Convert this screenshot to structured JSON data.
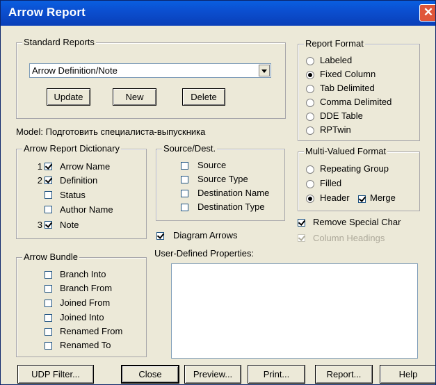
{
  "window": {
    "title": "Arrow Report",
    "close_glyph": "✕"
  },
  "standard_reports": {
    "legend": "Standard Reports",
    "selected": "Arrow Definition/Note",
    "update_label": "Update",
    "new_label": "New",
    "delete_label": "Delete"
  },
  "report_format": {
    "legend": "Report Format",
    "options": [
      {
        "label": "Labeled",
        "checked": false
      },
      {
        "label": "Fixed Column",
        "checked": true
      },
      {
        "label": "Tab Delimited",
        "checked": false
      },
      {
        "label": "Comma Delimited",
        "checked": false
      },
      {
        "label": "DDE Table",
        "checked": false
      },
      {
        "label": "RPTwin",
        "checked": false
      }
    ]
  },
  "model": {
    "label": "Model: ",
    "name": "Подготовить специалиста-выпускника"
  },
  "dictionary": {
    "legend": "Arrow Report Dictionary",
    "items": [
      {
        "num": "1",
        "label": "Arrow Name",
        "checked": true
      },
      {
        "num": "2",
        "label": "Definition",
        "checked": true
      },
      {
        "num": "",
        "label": "Status",
        "checked": false
      },
      {
        "num": "",
        "label": "Author Name",
        "checked": false
      },
      {
        "num": "3",
        "label": "Note",
        "checked": true
      }
    ]
  },
  "source_dest": {
    "legend": "Source/Dest.",
    "items": [
      {
        "label": "Source",
        "checked": false
      },
      {
        "label": "Source Type",
        "checked": false
      },
      {
        "label": "Destination Name",
        "checked": false
      },
      {
        "label": "Destination Type",
        "checked": false
      }
    ]
  },
  "multi_valued": {
    "legend": "Multi-Valued Format",
    "repeating": "Repeating Group",
    "filled": "Filled",
    "header": "Header",
    "merge": "Merge",
    "selected": "Header",
    "merge_checked": true
  },
  "remove_special": {
    "label": "Remove Special Char",
    "checked": true
  },
  "column_headings": {
    "label": "Column Headings",
    "checked": true,
    "disabled": true
  },
  "diagram_arrows": {
    "label": "Diagram Arrows",
    "checked": true
  },
  "udp": {
    "label": "User-Defined Properties:"
  },
  "bundle": {
    "legend": "Arrow Bundle",
    "items": [
      {
        "label": "Branch Into",
        "checked": false
      },
      {
        "label": "Branch From",
        "checked": false
      },
      {
        "label": "Joined From",
        "checked": false
      },
      {
        "label": "Joined Into",
        "checked": false
      },
      {
        "label": "Renamed From",
        "checked": false
      },
      {
        "label": "Renamed To",
        "checked": false
      }
    ]
  },
  "buttons": {
    "udp_filter": "UDP Filter...",
    "close": "Close",
    "preview": "Preview...",
    "print": "Print...",
    "report": "Report...",
    "help": "Help"
  }
}
